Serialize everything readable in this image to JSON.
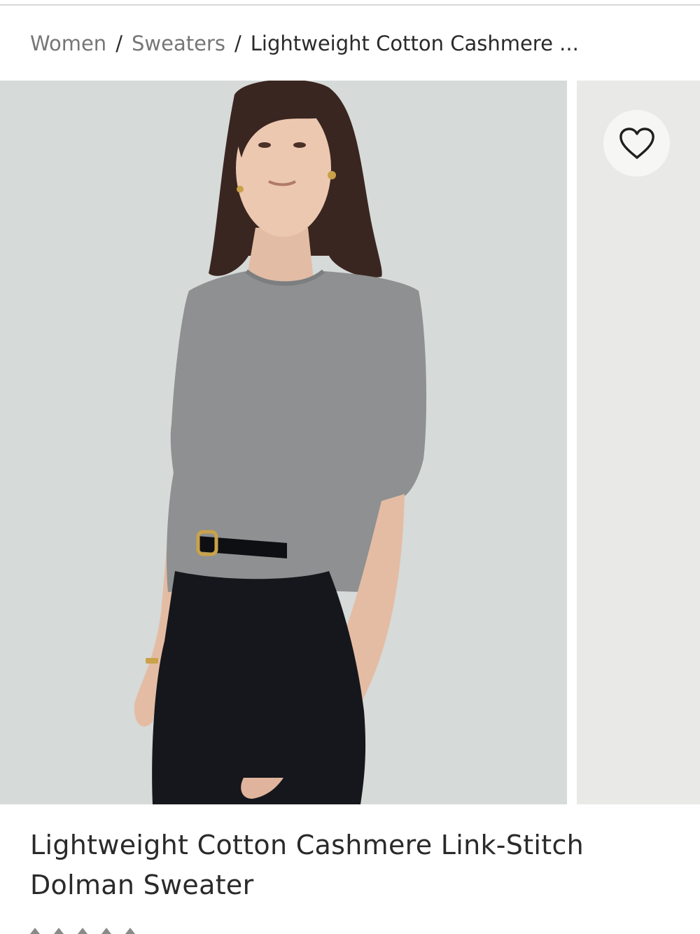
{
  "breadcrumb": {
    "items": [
      {
        "label": "Women"
      },
      {
        "label": "Sweaters"
      }
    ],
    "separator": "/",
    "current": "Lightweight Cotton Cashmere ..."
  },
  "gallery": {
    "favorite_icon": "heart-outline-icon"
  },
  "product": {
    "title_line1": "Lightweight Cotton Cashmere Link-Stitch",
    "title_line2": "Dolman Sweater"
  },
  "colors": {
    "photo_background": "#d6dad8",
    "next_photo_background": "#e9e9e7",
    "sweater_gray": "#8e9091",
    "pants_black": "#15171c",
    "link_gray": "#767676",
    "text_dark": "#2a2a2a"
  }
}
